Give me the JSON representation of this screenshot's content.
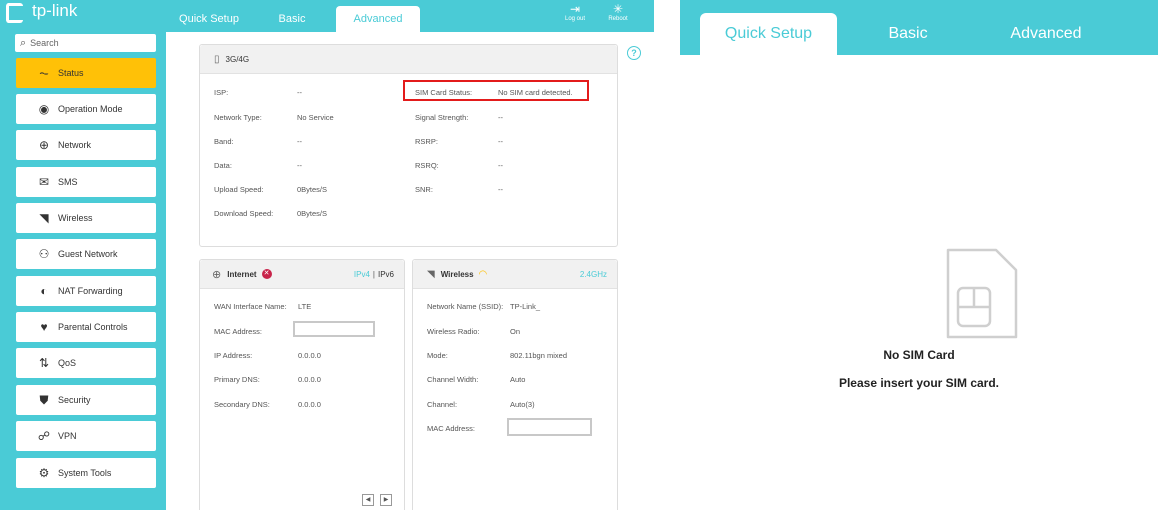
{
  "brand": {
    "logo_text": "tp-link",
    "accent": "#4acbd6",
    "active_nav": "#ffc107",
    "error_red": "#e31b1b"
  },
  "tabs": [
    "Quick Setup",
    "Basic",
    "Advanced"
  ],
  "top_icons": {
    "logout": "Log out",
    "reboot": "Reboot"
  },
  "search": {
    "placeholder": "Search"
  },
  "nav": [
    {
      "label": "Status",
      "icon": "pulse-icon"
    },
    {
      "label": "Operation Mode",
      "icon": "toggle-icon"
    },
    {
      "label": "Network",
      "icon": "globe-icon"
    },
    {
      "label": "SMS",
      "icon": "envelope-icon"
    },
    {
      "label": "Wireless",
      "icon": "wifi-icon"
    },
    {
      "label": "Guest Network",
      "icon": "guests-icon"
    },
    {
      "label": "NAT Forwarding",
      "icon": "nat-icon"
    },
    {
      "label": "Parental Controls",
      "icon": "heart-icon"
    },
    {
      "label": "QoS",
      "icon": "updown-arrows-icon"
    },
    {
      "label": "Security",
      "icon": "shield-icon"
    },
    {
      "label": "VPN",
      "icon": "vpn-icon"
    },
    {
      "label": "System Tools",
      "icon": "gear-icon"
    }
  ],
  "card_3g": {
    "title": "3G/4G",
    "left": [
      {
        "label": "ISP:",
        "value": "--"
      },
      {
        "label": "Network Type:",
        "value": "No Service"
      },
      {
        "label": "Band:",
        "value": "--"
      },
      {
        "label": "Data:",
        "value": "--"
      },
      {
        "label": "Upload Speed:",
        "value": "0Bytes/S"
      },
      {
        "label": "Download Speed:",
        "value": "0Bytes/S"
      }
    ],
    "right": [
      {
        "label": "SIM Card Status:",
        "value": "No SIM card detected."
      },
      {
        "label": "Signal Strength:",
        "value": "--"
      },
      {
        "label": "RSRP:",
        "value": "--"
      },
      {
        "label": "RSRQ:",
        "value": "--"
      },
      {
        "label": "SNR:",
        "value": "--"
      }
    ]
  },
  "card_internet": {
    "title": "Internet",
    "ipv4": "IPv4",
    "sep": "|",
    "ipv6": "IPv6",
    "rows": [
      {
        "label": "WAN Interface Name:",
        "value": "LTE"
      },
      {
        "label": "MAC Address:",
        "value": ""
      },
      {
        "label": "IP Address:",
        "value": "0.0.0.0"
      },
      {
        "label": "Primary DNS:",
        "value": "0.0.0.0"
      },
      {
        "label": "Secondary DNS:",
        "value": "0.0.0.0"
      }
    ]
  },
  "card_wireless": {
    "title": "Wireless",
    "band": "2.4GHz",
    "rows": [
      {
        "label": "Network Name (SSID):",
        "value": "TP-Link_"
      },
      {
        "label": "Wireless Radio:",
        "value": "On"
      },
      {
        "label": "Mode:",
        "value": "802.11bgn mixed"
      },
      {
        "label": "Channel Width:",
        "value": "Auto"
      },
      {
        "label": "Channel:",
        "value": "Auto(3)"
      },
      {
        "label": "MAC Address:",
        "value": ""
      }
    ]
  },
  "mobile": {
    "tabs": [
      "Quick Setup",
      "Basic",
      "Advanced"
    ],
    "title": "No SIM Card",
    "subtitle": "Please insert your SIM card."
  }
}
